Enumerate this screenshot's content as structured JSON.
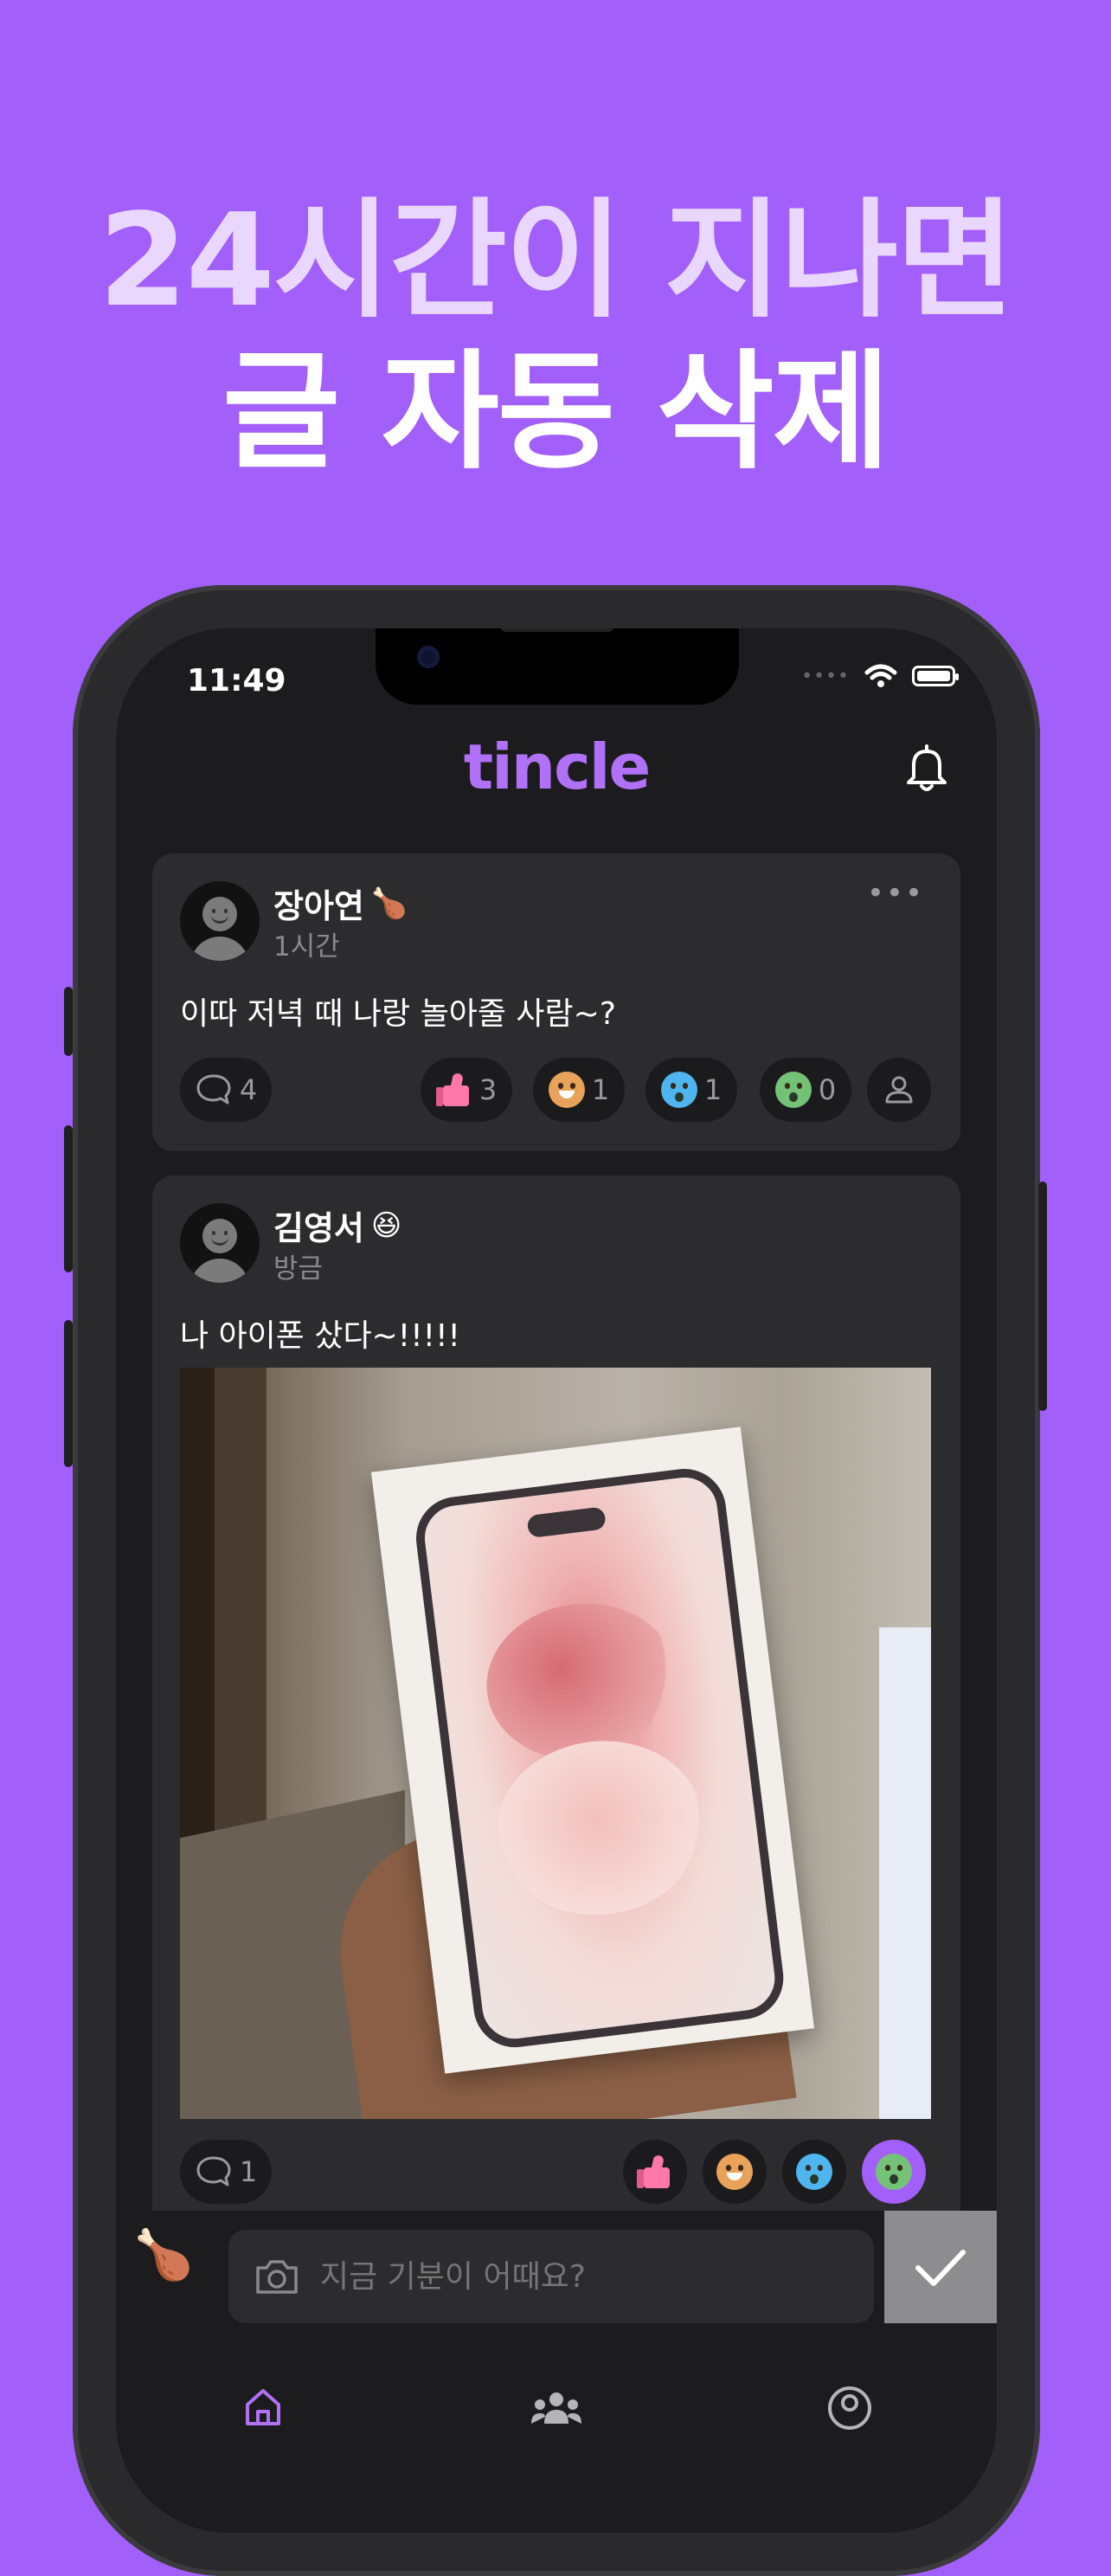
{
  "headline": {
    "line1": "24시간이 지나면",
    "line2": "글 자동 삭제"
  },
  "status_bar": {
    "time": "11:49"
  },
  "app": {
    "title": "tincle"
  },
  "posts": [
    {
      "author": "장아연",
      "badge": "🍗",
      "time": "1시간",
      "text": "이따 저녁 때 나랑 놀아줄 사람~?",
      "comments": "4",
      "reactions": [
        {
          "type": "thumbs-up",
          "count": "3"
        },
        {
          "type": "laugh",
          "count": "1"
        },
        {
          "type": "cry",
          "count": "1"
        },
        {
          "type": "surprise",
          "count": "0"
        }
      ]
    },
    {
      "author": "김영서",
      "badge": "😆",
      "time": "방금",
      "text": "나 아이폰 샀다~!!!!!",
      "comments": "1"
    }
  ],
  "composer": {
    "placeholder": "지금 기분이 어때요?"
  },
  "colors": {
    "background": "#a35ff9",
    "accent": "#b071f7",
    "screen": "#1c1c1e",
    "card": "#2c2c2e"
  }
}
